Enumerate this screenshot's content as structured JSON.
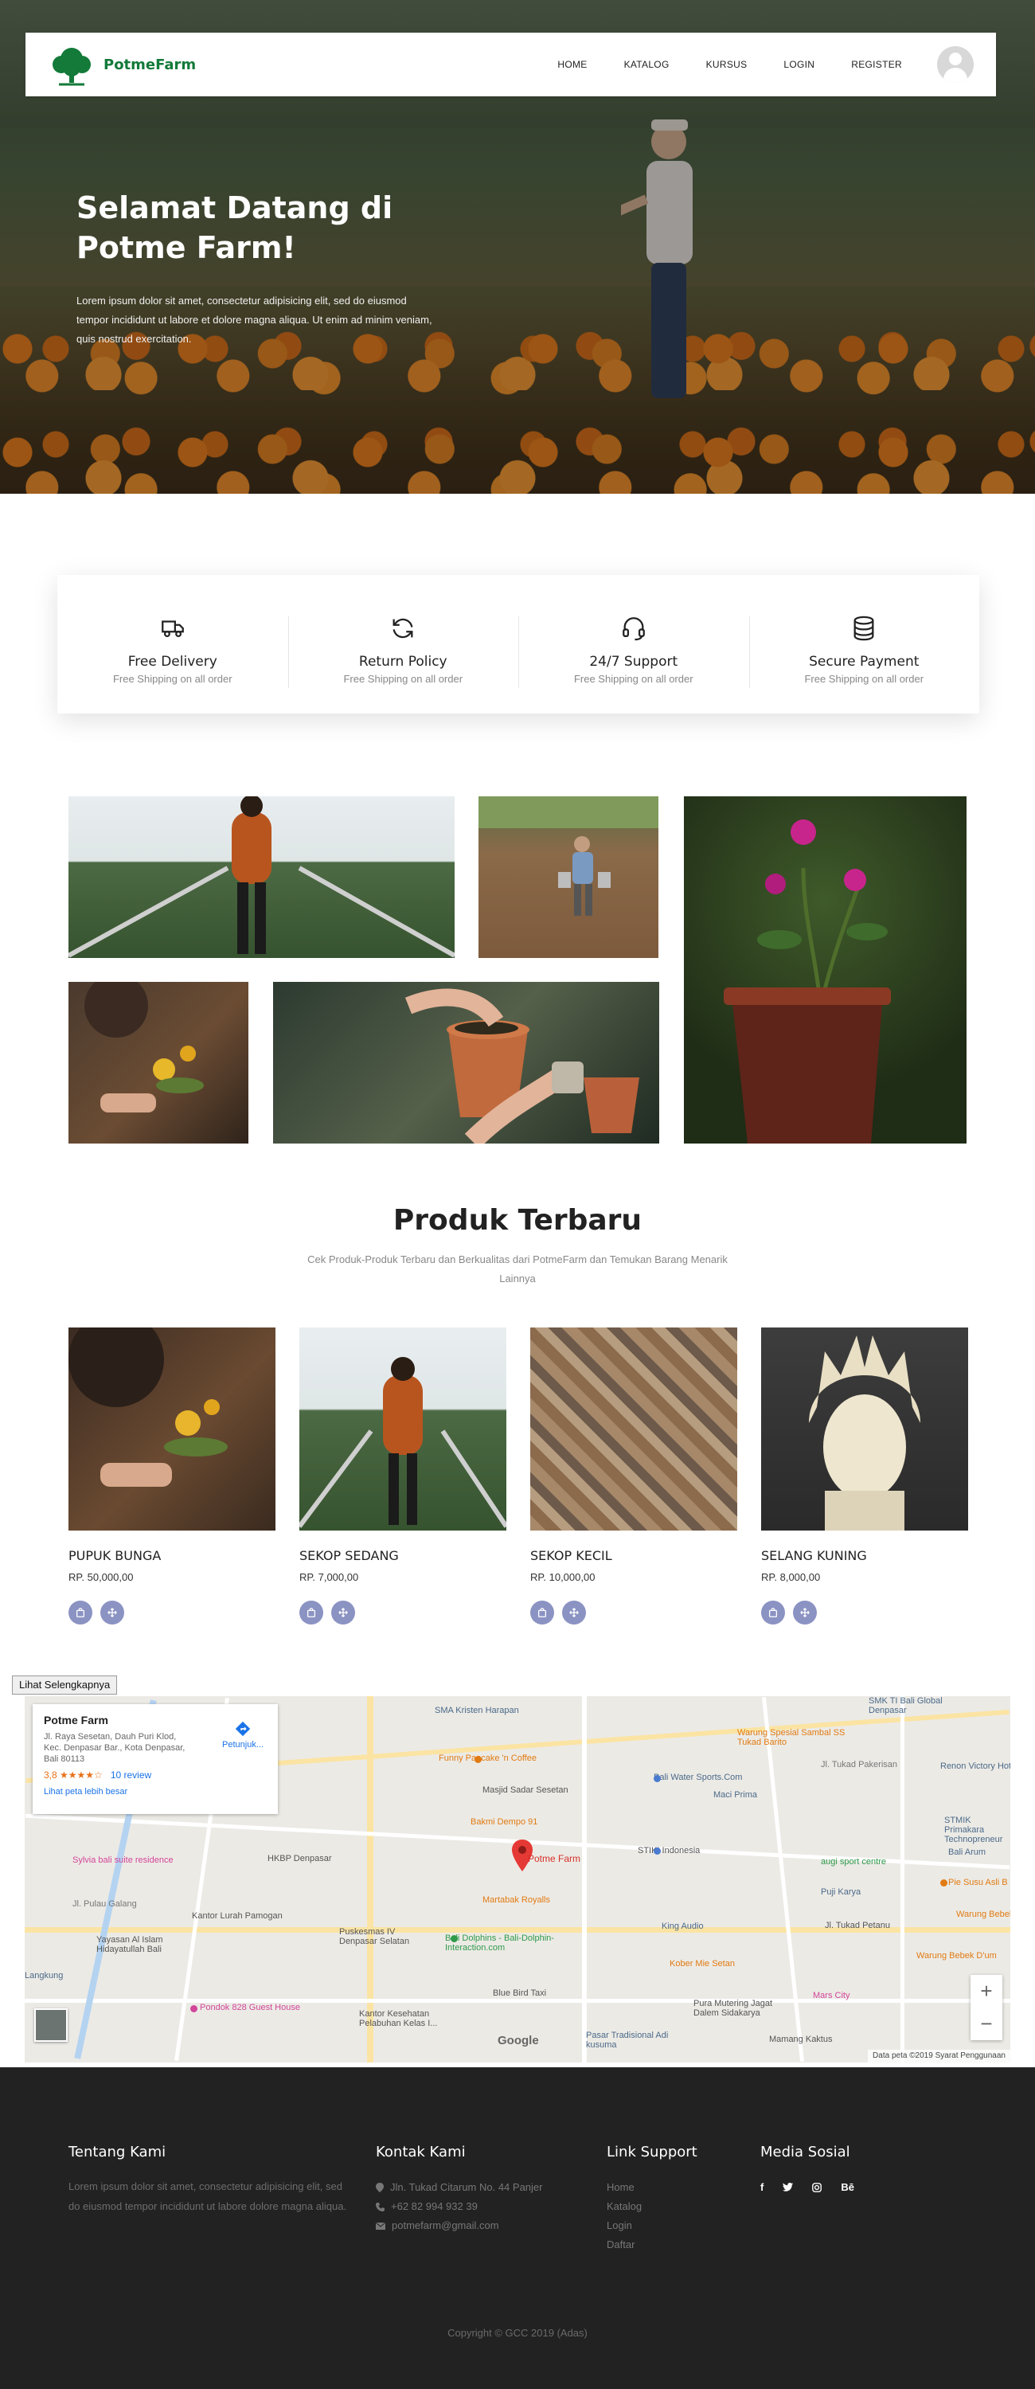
{
  "brand": {
    "name": "PotmeFarm",
    "accent": "#137a3a"
  },
  "nav": {
    "items": [
      "HOME",
      "KATALOG",
      "KURSUS",
      "LOGIN",
      "REGISTER"
    ],
    "avatar_icon": "user-avatar-icon"
  },
  "hero": {
    "title": "Selamat Datang di Potme Farm!",
    "text": "Lorem ipsum dolor sit amet, consectetur adipisicing elit, sed do eiusmod tempor incididunt ut labore et dolore magna aliqua. Ut enim ad minim veniam, quis nostrud exercitation."
  },
  "features": [
    {
      "icon": "truck-icon",
      "title": "Free Delivery",
      "sub": "Free Shipping on all order"
    },
    {
      "icon": "refresh-icon",
      "title": "Return Policy",
      "sub": "Free Shipping on all order"
    },
    {
      "icon": "headset-icon",
      "title": "24/7 Support",
      "sub": "Free Shipping on all order"
    },
    {
      "icon": "database-icon",
      "title": "Secure Payment",
      "sub": "Free Shipping on all order"
    }
  ],
  "products_section": {
    "title": "Produk Terbaru",
    "subtitle": "Cek Produk-Produk Terbaru dan Berkualitas dari PotmeFarm dan Temukan Barang Menarik Lainnya"
  },
  "products": [
    {
      "name": "PUPUK BUNGA",
      "price": "RP. 50,000,00"
    },
    {
      "name": "SEKOP SEDANG",
      "price": "RP. 7,000,00"
    },
    {
      "name": "SEKOP KECIL",
      "price": "RP. 10,000,00"
    },
    {
      "name": "SELANG KUNING",
      "price": "RP. 8,000,00"
    }
  ],
  "map": {
    "view_larger": "Lihat Selengkapnya",
    "place": "Potme Farm",
    "address": "Jl. Raya Sesetan, Dauh Puri Klod, Kec. Denpasar Bar., Kota Denpasar, Bali 80113",
    "rating": "3,8 ★★★★☆",
    "reviews": "10 review",
    "bigger_map": "Lihat peta lebih besar",
    "directions": "Petunjuk...",
    "marker_label": "Potme Farm",
    "footer": "Data peta ©2019   Syarat Penggunaan",
    "google": "Google",
    "labels": [
      "SMA Kristen Harapan",
      "Funny Pancake 'n Coffee",
      "Masjid Sadar Sesetan",
      "Bali Water Sports.Com",
      "Bakmi Dempo 91",
      "HKBP Denpasar",
      "Kantor Lurah Pamogan",
      "Puskesmas IV Denpasar Selatan",
      "Martabak Royalls",
      "STIKI Indonesia",
      "Bali Dolphins - Bali-Dolphin-Interaction.com",
      "Blue Bird Taxi",
      "Kantor Kesehatan Pelabuhan Kelas I...",
      "Pondok 828 Guest House",
      "Pasar Tradisional Adi kusuma",
      "Pura Mutering Jagat Dalem Sidakarya",
      "Mamang Kaktus",
      "King Audio",
      "Kober Mie Setan",
      "Mars City",
      "Warung Bebek D'um",
      "Pie Susu Asli B",
      "STMIK Primakara Technopreneur",
      "Bali Arum",
      "augi sport centre",
      "Puji Karya",
      "Renon Victory Hotel",
      "Jl. Tukad Petanu",
      "Sylvia bali suite residence",
      "Yayasan Al Islam Hidayatullah Bali",
      "Warung Spesial Sambal SS Tukad Barito",
      "SMK TI Bali Global Denpasar",
      "Maci Prima",
      "Warung Bebek Seulu",
      "Jl. Pulau Galang",
      "Langkung",
      "Jl. Tukad Pakerisan"
    ]
  },
  "footer": {
    "about": {
      "title": "Tentang Kami",
      "text": "Lorem ipsum dolor sit amet, consectetur adipisicing elit, sed do eiusmod tempor incididunt ut labore dolore magna aliqua."
    },
    "contact": {
      "title": "Kontak Kami",
      "address": "Jln. Tukad Citarum No. 44 Panjer",
      "phone": "+62 82 994 932 39",
      "email": "potmefarm@gmail.com"
    },
    "links": {
      "title": "Link Support",
      "items": [
        "Home",
        "Katalog",
        "Login",
        "Daftar"
      ]
    },
    "social": {
      "title": "Media Sosial",
      "items": [
        "f",
        "t",
        "o",
        "Bē"
      ]
    },
    "copyright": "Copyright © GCC 2019 (Adas)"
  }
}
